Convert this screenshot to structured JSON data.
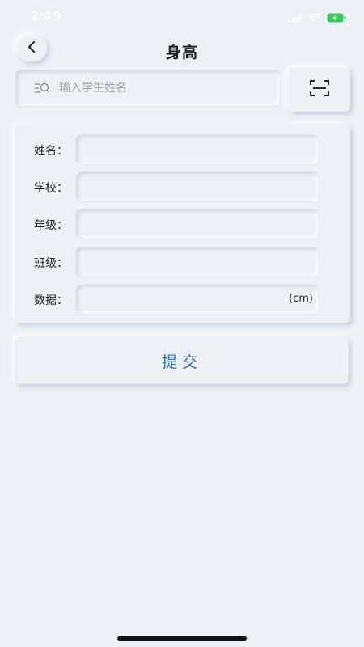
{
  "status_bar": {
    "time": "2:49",
    "battery_color": "#34c759"
  },
  "header": {
    "title": "身高"
  },
  "search": {
    "placeholder": "输入学生姓名",
    "value": ""
  },
  "form": {
    "fields": [
      {
        "label": "姓名：",
        "value": ""
      },
      {
        "label": "学校：",
        "value": ""
      },
      {
        "label": "年级：",
        "value": ""
      },
      {
        "label": "班级：",
        "value": ""
      },
      {
        "label": "数据：",
        "value": "",
        "unit": "(cm)"
      }
    ]
  },
  "actions": {
    "submit_label": "提交"
  },
  "colors": {
    "background": "#eef1f4",
    "accent": "#2f6fb0"
  }
}
